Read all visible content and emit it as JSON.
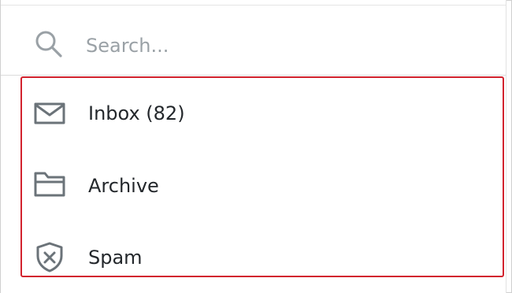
{
  "search": {
    "placeholder": "Search...",
    "icon": "search-icon"
  },
  "folders": [
    {
      "label": "Inbox (82)",
      "icon": "envelope-icon"
    },
    {
      "label": "Archive",
      "icon": "folder-icon"
    },
    {
      "label": "Spam",
      "icon": "shield-x-icon"
    }
  ],
  "colors": {
    "highlight_border": "#d2222e",
    "icon_gray": "#6b7379",
    "text": "#23272b",
    "placeholder": "#9aa1a6"
  }
}
